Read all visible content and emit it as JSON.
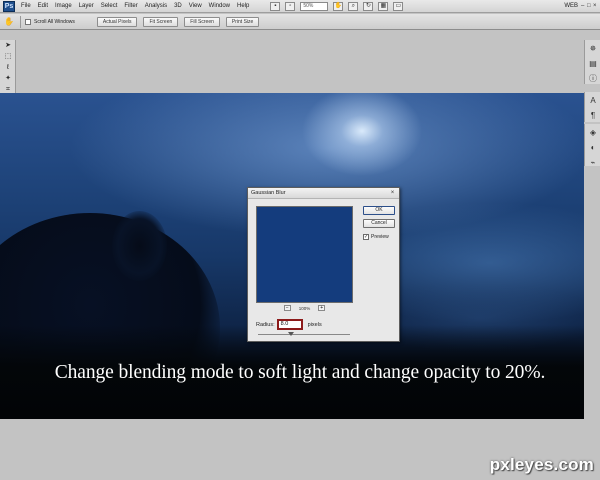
{
  "app": {
    "logo_text": "Ps",
    "workspace": "WEB"
  },
  "menu": {
    "items": [
      {
        "label": "File"
      },
      {
        "label": "Edit"
      },
      {
        "label": "Image"
      },
      {
        "label": "Layer"
      },
      {
        "label": "Select"
      },
      {
        "label": "Filter"
      },
      {
        "label": "Analysis"
      },
      {
        "label": "3D"
      },
      {
        "label": "View"
      },
      {
        "label": "Window"
      },
      {
        "label": "Help"
      }
    ],
    "zoom_value": "50%"
  },
  "options_bar": {
    "scroll_all_label": "Scroll All Windows",
    "buttons": [
      {
        "label": "Actual Pixels"
      },
      {
        "label": "Fit Screen"
      },
      {
        "label": "Fill Screen"
      },
      {
        "label": "Print Size"
      }
    ]
  },
  "dialog": {
    "title": "Gaussian Blur",
    "ok_label": "OK",
    "cancel_label": "Cancel",
    "preview_label": "Preview",
    "preview_checked": "✓",
    "zoom_percent": "100%",
    "zoom_out": "−",
    "zoom_in": "+",
    "radius_label": "Radius:",
    "radius_value": "8.0",
    "radius_unit": "pixels",
    "preview_color": "#143c7d"
  },
  "caption": "Change blending mode to soft light and change opacity to 20%.",
  "watermark": "pxleyes.com",
  "colors": {
    "foreground": "#8a1010",
    "background": "#ffffff",
    "accent_highlight": "#8c1a1a"
  }
}
